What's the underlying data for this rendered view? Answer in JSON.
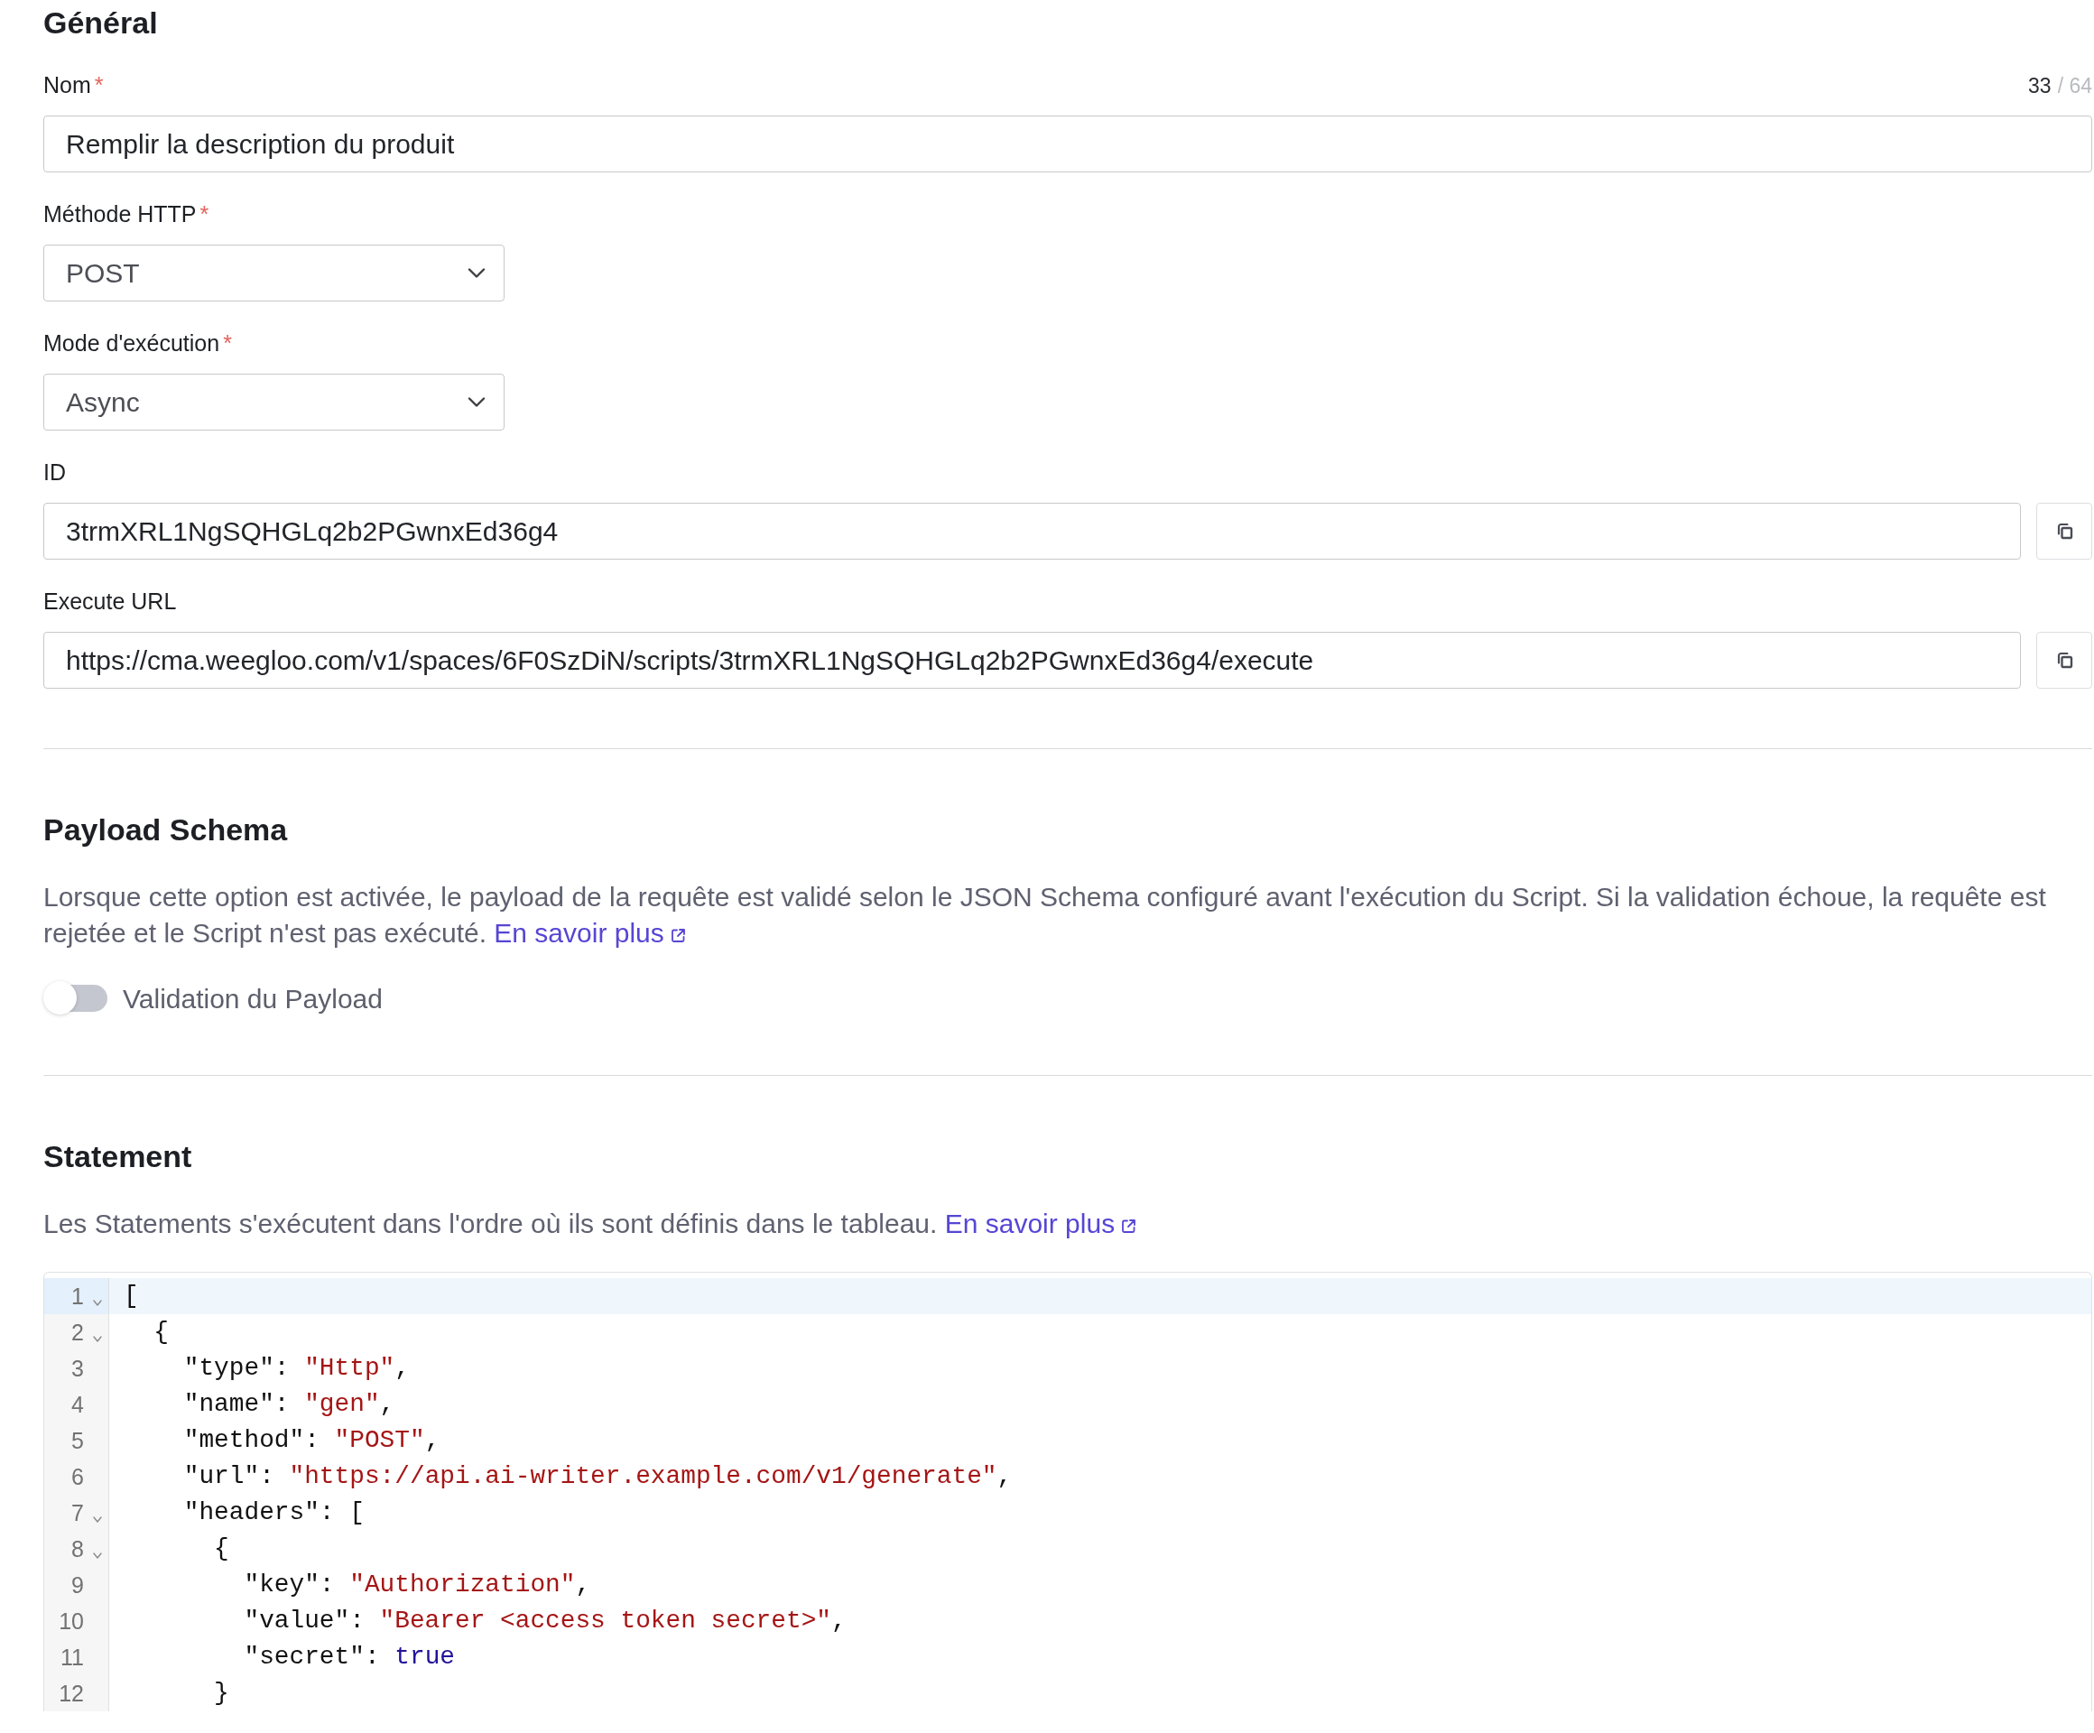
{
  "general": {
    "title": "Général",
    "fields": [
      {
        "kind": "text",
        "label": "Nom",
        "required_mark": "*",
        "value": "Remplir la description du produit",
        "counter": {
          "count": "33",
          "limit": "/ 64"
        }
      },
      {
        "kind": "select",
        "label": "Méthode HTTP",
        "required_mark": "*",
        "value": "POST"
      },
      {
        "kind": "select",
        "label": "Mode d'exécution",
        "required_mark": "*",
        "value": "Async"
      },
      {
        "kind": "copy",
        "label": "ID",
        "value": "3trmXRL1NgSQHGLq2b2PGwnxEd36g4"
      },
      {
        "kind": "copy",
        "label": "Execute URL",
        "value": "https://cma.weegloo.com/v1/spaces/6F0SzDiN/scripts/3trmXRL1NgSQHGLq2b2PGwnxEd36g4/execute"
      }
    ]
  },
  "payload_schema": {
    "title": "Payload Schema",
    "description": "Lorsque cette option est activée, le payload de la requête est validé selon le JSON Schema configuré avant l'exécution du Script. Si la validation échoue, la requête est rejetée et le Script n'est pas exécuté.",
    "link": "En savoir plus",
    "toggle": {
      "label": "Validation du Payload",
      "on": false
    }
  },
  "statement": {
    "title": "Statement",
    "description": "Les Statements s'exécutent dans l'ordre où ils sont définis dans le tableau.",
    "link": "En savoir plus",
    "editor": {
      "lines": [
        {
          "number": "1",
          "foldable": true,
          "active": true,
          "tokens": [
            {
              "kind": "text",
              "text": "["
            }
          ]
        },
        {
          "number": "2",
          "foldable": true,
          "active": false,
          "tokens": [
            {
              "kind": "text",
              "text": "  {"
            }
          ]
        },
        {
          "number": "3",
          "foldable": false,
          "active": false,
          "tokens": [
            {
              "kind": "text",
              "text": "    \"type\": "
            },
            {
              "kind": "string",
              "text": "\"Http\""
            },
            {
              "kind": "text",
              "text": ","
            }
          ]
        },
        {
          "number": "4",
          "foldable": false,
          "active": false,
          "tokens": [
            {
              "kind": "text",
              "text": "    \"name\": "
            },
            {
              "kind": "string",
              "text": "\"gen\""
            },
            {
              "kind": "text",
              "text": ","
            }
          ]
        },
        {
          "number": "5",
          "foldable": false,
          "active": false,
          "tokens": [
            {
              "kind": "text",
              "text": "    \"method\": "
            },
            {
              "kind": "string",
              "text": "\"POST\""
            },
            {
              "kind": "text",
              "text": ","
            }
          ]
        },
        {
          "number": "6",
          "foldable": false,
          "active": false,
          "tokens": [
            {
              "kind": "text",
              "text": "    \"url\": "
            },
            {
              "kind": "string",
              "text": "\"https://api.ai-writer.example.com/v1/generate\""
            },
            {
              "kind": "text",
              "text": ","
            }
          ]
        },
        {
          "number": "7",
          "foldable": true,
          "active": false,
          "tokens": [
            {
              "kind": "text",
              "text": "    \"headers\": ["
            }
          ]
        },
        {
          "number": "8",
          "foldable": true,
          "active": false,
          "tokens": [
            {
              "kind": "text",
              "text": "      {"
            }
          ]
        },
        {
          "number": "9",
          "foldable": false,
          "active": false,
          "tokens": [
            {
              "kind": "text",
              "text": "        \"key\": "
            },
            {
              "kind": "string",
              "text": "\"Authorization\""
            },
            {
              "kind": "text",
              "text": ","
            }
          ]
        },
        {
          "number": "10",
          "foldable": false,
          "active": false,
          "tokens": [
            {
              "kind": "text",
              "text": "        \"value\": "
            },
            {
              "kind": "string",
              "text": "\"Bearer <access token secret>\""
            },
            {
              "kind": "text",
              "text": ","
            }
          ]
        },
        {
          "number": "11",
          "foldable": false,
          "active": false,
          "tokens": [
            {
              "kind": "text",
              "text": "        \"secret\": "
            },
            {
              "kind": "keyword",
              "text": "true"
            }
          ]
        },
        {
          "number": "12",
          "foldable": false,
          "active": false,
          "tokens": [
            {
              "kind": "text",
              "text": "      }"
            }
          ]
        }
      ]
    }
  }
}
